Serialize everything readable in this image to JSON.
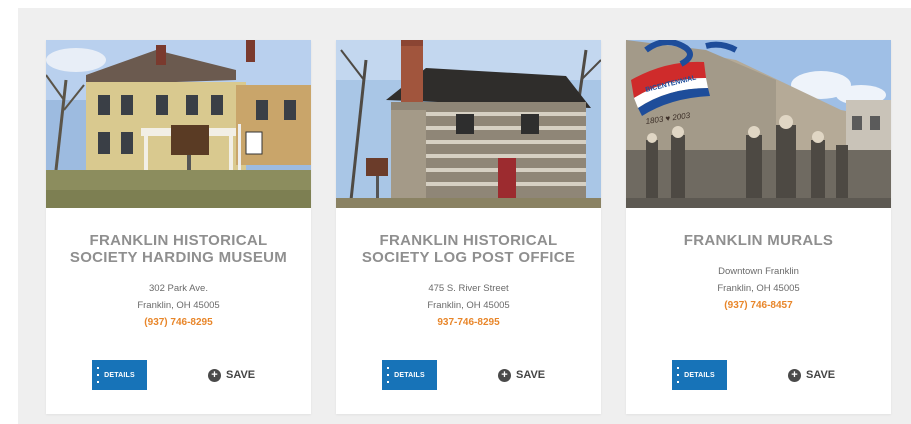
{
  "cards": [
    {
      "title": "FRANKLIN HISTORICAL SOCIETY HARDING MUSEUM",
      "address_line1": "302 Park Ave.",
      "address_line2": "Franklin, OH 45005",
      "phone": "(937) 746-8295",
      "details_label": "DETAILS",
      "save_label": "SAVE",
      "photo_icon": "house-photo"
    },
    {
      "title": "FRANKLIN HISTORICAL SOCIETY LOG POST OFFICE",
      "address_line1": "475 S. River Street",
      "address_line2": "Franklin, OH 45005",
      "phone": "937-746-8295",
      "details_label": "DETAILS",
      "save_label": "SAVE",
      "photo_icon": "log-cabin-photo"
    },
    {
      "title": "FRANKLIN MURALS",
      "address_line1": "Downtown Franklin",
      "address_line2": "Franklin, OH 45005",
      "phone": "(937) 746-8457",
      "details_label": "DETAILS",
      "save_label": "SAVE",
      "photo_icon": "mural-photo"
    }
  ],
  "colors": {
    "details_button": "#1773b8",
    "phone_text": "#e8862a",
    "title_text": "#8f8f8f",
    "panel_background": "#efefef"
  }
}
